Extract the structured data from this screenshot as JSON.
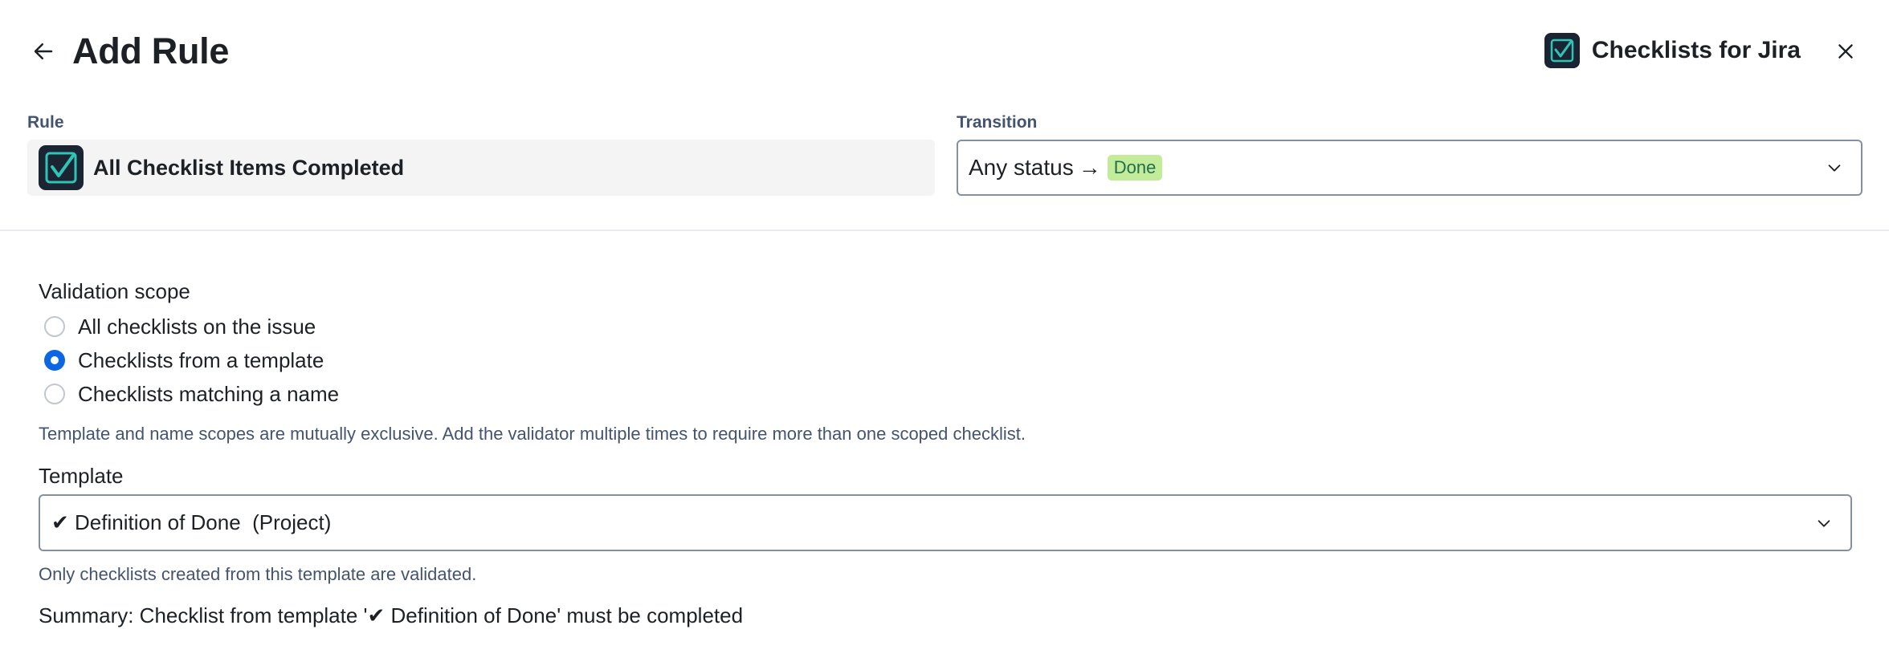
{
  "header": {
    "title": "Add Rule",
    "app_name": "Checklists for Jira",
    "back_icon": "arrow-left-icon",
    "close_icon": "close-icon"
  },
  "rule": {
    "label": "Rule",
    "name": "All Checklist Items Completed",
    "icon": "checklist-logo-icon"
  },
  "transition": {
    "label": "Transition",
    "from": "Any status",
    "arrow": "→",
    "to": "Done",
    "to_color": "#c3ec9a"
  },
  "validation_scope": {
    "heading": "Validation scope",
    "options": [
      {
        "label": "All checklists on the issue",
        "selected": false
      },
      {
        "label": "Checklists from a template",
        "selected": true
      },
      {
        "label": "Checklists matching a name",
        "selected": false
      }
    ],
    "helper": "Template and name scopes are mutually exclusive. Add the validator multiple times to require more than one scoped checklist."
  },
  "template": {
    "label": "Template",
    "value": "✔ Definition of Done  (Project)",
    "helper": "Only checklists created from this template are validated."
  },
  "summary": "Summary: Checklist from template '✔ Definition of Done' must be completed",
  "colors": {
    "accent": "#0c66e4",
    "logo_bg": "#1b2433",
    "logo_check": "#2ec4b6"
  }
}
